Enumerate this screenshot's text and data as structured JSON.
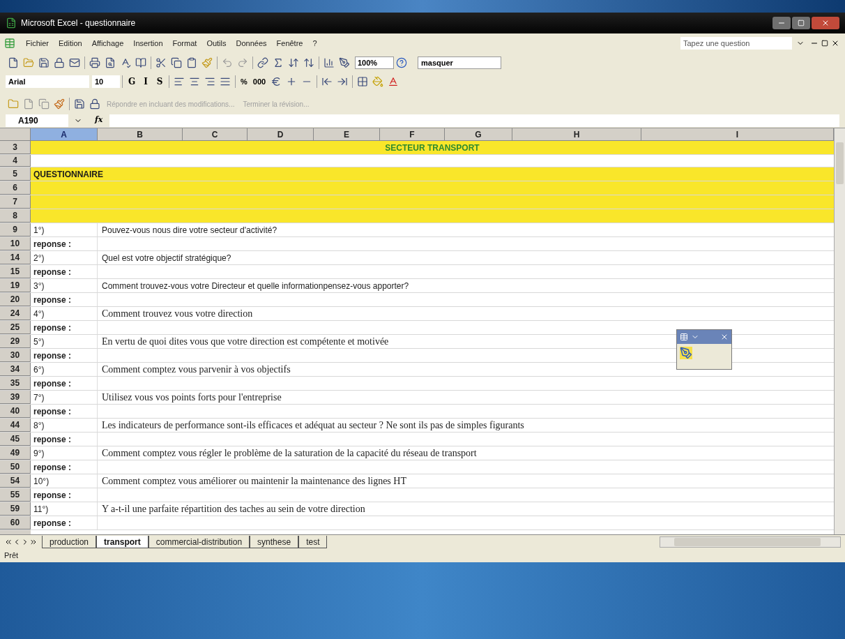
{
  "window": {
    "title": "Microsoft Excel - questionnaire"
  },
  "menu": [
    "Fichier",
    "Edition",
    "Affichage",
    "Insertion",
    "Format",
    "Outils",
    "Données",
    "Fenêtre",
    "?"
  ],
  "help_box": {
    "placeholder": "Tapez une question"
  },
  "standard_toolbar": {
    "zoom": "100%",
    "view_dropdown": "masquer"
  },
  "formatting_toolbar": {
    "font": "Arial",
    "size": "10",
    "style_buttons": [
      "G",
      "I",
      "S"
    ],
    "number_buttons": [
      "%",
      "000"
    ]
  },
  "review_toolbar": {
    "items": [
      {
        "label": "Répondre en incluant des modifications...",
        "disabled": true
      },
      {
        "label": "Terminer la révision...",
        "disabled": true
      }
    ]
  },
  "formula_bar": {
    "name_box": "A190",
    "function_label": "fx"
  },
  "columns": [
    {
      "label": "A",
      "selected": true
    },
    {
      "label": "B",
      "selected": false
    },
    {
      "label": "C",
      "selected": false
    },
    {
      "label": "D",
      "selected": false
    },
    {
      "label": "E",
      "selected": false
    },
    {
      "label": "F",
      "selected": false
    },
    {
      "label": "G",
      "selected": false
    },
    {
      "label": "H",
      "selected": false
    },
    {
      "label": "I",
      "selected": false
    }
  ],
  "rows": [
    {
      "number": "3",
      "kind": "banner",
      "text": "SECTEUR TRANSPORT"
    },
    {
      "number": "4",
      "kind": "blank"
    },
    {
      "number": "5",
      "kind": "heading",
      "text": "QUESTIONNAIRE"
    },
    {
      "number": "6",
      "kind": "filler"
    },
    {
      "number": "7",
      "kind": "filler"
    },
    {
      "number": "8",
      "kind": "filler"
    },
    {
      "number": "9",
      "kind": "question",
      "label": "1°)",
      "text": "Pouvez-vous nous dire votre secteur d'activité?",
      "serif": false
    },
    {
      "number": "10",
      "kind": "answer",
      "label": "reponse :"
    },
    {
      "number": "14",
      "kind": "question",
      "label": "2°)",
      "text": "Quel est votre objectif stratégique?",
      "serif": false
    },
    {
      "number": "15",
      "kind": "answer",
      "label": "reponse :"
    },
    {
      "number": "19",
      "kind": "question",
      "label": "3°)",
      "text": "Comment trouvez-vous votre Directeur et quelle informationpensez-vous apporter?",
      "serif": false
    },
    {
      "number": "20",
      "kind": "answer",
      "label": "reponse :"
    },
    {
      "number": "24",
      "kind": "question",
      "label": "4°)",
      "text": "Comment trouvez vous votre direction",
      "serif": true
    },
    {
      "number": "25",
      "kind": "answer",
      "label": "reponse :"
    },
    {
      "number": "29",
      "kind": "question",
      "label": "5°)",
      "text": "En vertu de quoi dites vous que votre direction est compétente et motivée",
      "serif": true
    },
    {
      "number": "30",
      "kind": "answer",
      "label": "reponse :"
    },
    {
      "number": "34",
      "kind": "question",
      "label": "6°)",
      "text": "Comment comptez vous parvenir à vos objectifs",
      "serif": true
    },
    {
      "number": "35",
      "kind": "answer",
      "label": "reponse :"
    },
    {
      "number": "39",
      "kind": "question",
      "label": "7°)",
      "text": "Utilisez vous vos points forts pour l'entreprise",
      "serif": true
    },
    {
      "number": "40",
      "kind": "answer",
      "label": "reponse :"
    },
    {
      "number": "44",
      "kind": "question",
      "label": "8°)",
      "text": "Les indicateurs de performance sont-ils efficaces et adéquat au secteur ? Ne sont ils pas de simples figurants",
      "serif": true
    },
    {
      "number": "45",
      "kind": "answer",
      "label": "reponse :"
    },
    {
      "number": "49",
      "kind": "question",
      "label": "9°)",
      "text": "Comment comptez vous régler le problème de la saturation de la capacité du réseau de transport",
      "serif": true
    },
    {
      "number": "50",
      "kind": "answer",
      "label": "reponse :"
    },
    {
      "number": "54",
      "kind": "question",
      "label": "10°)",
      "text": "Comment comptez vous améliorer ou maintenir la maintenance des lignes HT",
      "serif": true
    },
    {
      "number": "55",
      "kind": "answer",
      "label": "reponse :"
    },
    {
      "number": "59",
      "kind": "question",
      "label": "11°)",
      "text": "Y a-t-il une parfaite répartition des taches au sein de votre direction",
      "serif": true
    },
    {
      "number": "60",
      "kind": "answer",
      "label": "reponse :"
    }
  ],
  "sheet_tabs": [
    {
      "label": "production",
      "selected": false
    },
    {
      "label": "transport",
      "selected": true
    },
    {
      "label": "commercial-distribution",
      "selected": false
    },
    {
      "label": "synthese",
      "selected": false
    },
    {
      "label": "test",
      "selected": false
    }
  ],
  "status_bar": "Prêt"
}
